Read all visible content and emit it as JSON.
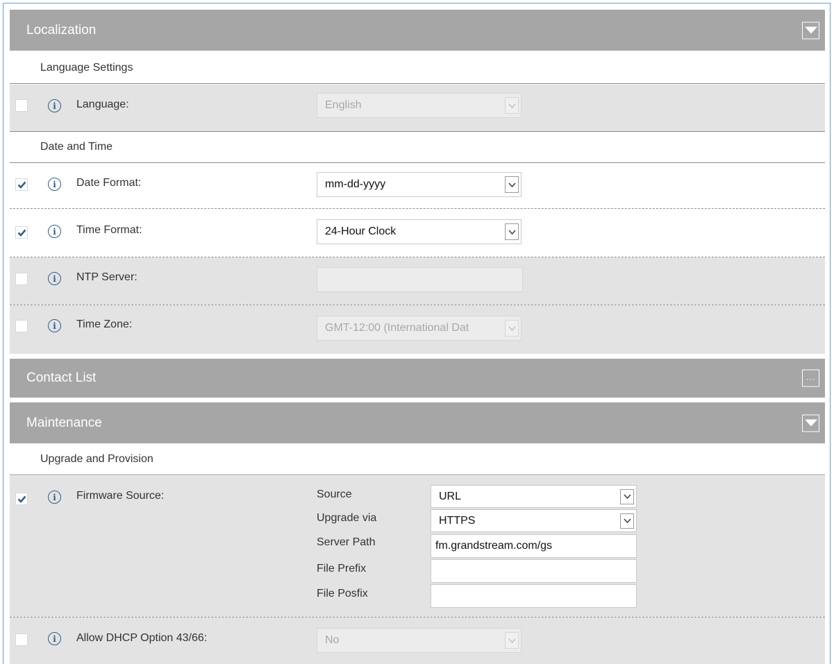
{
  "sections": {
    "localization": {
      "title": "Localization",
      "button_icon": "collapse-arrow-down"
    },
    "contact_list": {
      "title": "Contact List",
      "button_icon": "more-dots",
      "button_label": "..."
    },
    "maintenance": {
      "title": "Maintenance",
      "button_icon": "collapse-arrow-down"
    }
  },
  "localization": {
    "language_settings": {
      "heading": "Language Settings",
      "language": {
        "checked": false,
        "label": "Language:",
        "value": "English",
        "disabled": true
      }
    },
    "date_time": {
      "heading": "Date and Time",
      "date_format": {
        "checked": true,
        "label": "Date Format:",
        "value": "mm-dd-yyyy",
        "disabled": false
      },
      "time_format": {
        "checked": true,
        "label": "Time Format:",
        "value": "24-Hour Clock",
        "disabled": false
      },
      "ntp_server": {
        "checked": false,
        "label": "NTP Server:",
        "value": "",
        "disabled": true
      },
      "time_zone": {
        "checked": false,
        "label": "Time Zone:",
        "value": "GMT-12:00 (International Dat",
        "disabled": true
      }
    }
  },
  "maintenance": {
    "upgrade": {
      "heading": "Upgrade and Provision",
      "firmware_source": {
        "checked": true,
        "label": "Firmware Source:",
        "source_label": "Source",
        "source_value": "URL",
        "upgrade_via_label": "Upgrade via",
        "upgrade_via_value": "HTTPS",
        "server_path_label": "Server Path",
        "server_path_value": "fm.grandstream.com/gs",
        "file_prefix_label": "File Prefix",
        "file_prefix_value": "",
        "file_posfix_label": "File Posfix",
        "file_posfix_value": ""
      },
      "dhcp_option": {
        "checked": false,
        "label": "Allow DHCP Option 43/66:",
        "value": "No",
        "disabled": true
      }
    }
  },
  "colors": {
    "section_header_bg": "#a6a6a6",
    "row_gray_bg": "#e3e3e3",
    "checkmark": "#2c5e8a",
    "info_icon": "#2c5e8a",
    "frame_border": "#6a9bd1"
  }
}
